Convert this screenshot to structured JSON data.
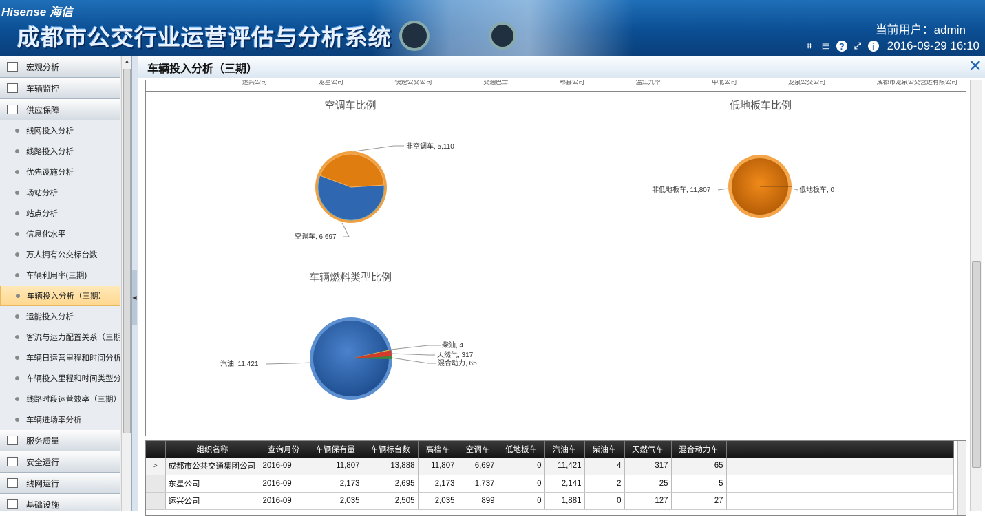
{
  "header": {
    "logo": "Hisense 海信",
    "title": "成都市公交行业运营评估与分析系统",
    "user_label": "当前用户：admin",
    "datetime": "2016-09-29 16:10"
  },
  "sidebar": {
    "groups_top": [
      {
        "label": "宏观分析",
        "icon": "chart-icon"
      },
      {
        "label": "车辆监控",
        "icon": "monitor-icon"
      },
      {
        "label": "供应保障",
        "icon": "supply-icon"
      }
    ],
    "items": [
      {
        "label": "线网投入分析"
      },
      {
        "label": "线路投入分析"
      },
      {
        "label": "优先设施分析"
      },
      {
        "label": "场站分析"
      },
      {
        "label": "站点分析"
      },
      {
        "label": "信息化水平"
      },
      {
        "label": "万人拥有公交标台数"
      },
      {
        "label": "车辆利用率(三期)"
      },
      {
        "label": "车辆投入分析（三期）"
      },
      {
        "label": "运能投入分析"
      },
      {
        "label": "客流与运力配置关系（三期）"
      },
      {
        "label": "车辆日运营里程和时间分析"
      },
      {
        "label": "车辆投入里程和时间类型分析"
      },
      {
        "label": "线路时段运营效率（三期）"
      },
      {
        "label": "车辆进场率分析"
      }
    ],
    "groups_bottom": [
      {
        "label": "服务质量",
        "icon": "service-icon"
      },
      {
        "label": "安全运行",
        "icon": "safety-icon"
      },
      {
        "label": "线网运行",
        "icon": "network-icon"
      },
      {
        "label": "基础设施",
        "icon": "infra-icon"
      }
    ]
  },
  "panel": {
    "title": "车辆投入分析（三期）",
    "top_strip": [
      "运兴公司",
      "龙星公司",
      "快速公交公司",
      "交通巴士",
      "郫县公司",
      "温江九华",
      "中北公司",
      "龙泉公交公司",
      "成都市龙泉公交营运有限公司"
    ]
  },
  "charts": {
    "ac": {
      "title": "空调车比例",
      "labels": [
        "非空调车, 5,110",
        "空调车, 6,697"
      ]
    },
    "lowfloor": {
      "title": "低地板车比例",
      "labels": [
        "非低地板车, 11,807",
        "低地板车, 0"
      ]
    },
    "fuel": {
      "title": "车辆燃料类型比例",
      "labels": [
        "汽油, 11,421",
        "柴油, 4",
        "天然气, 317",
        "混合动力, 65"
      ]
    }
  },
  "chart_data": [
    {
      "type": "pie",
      "title": "空调车比例",
      "categories": [
        "空调车",
        "非空调车"
      ],
      "values": [
        6697,
        5110
      ]
    },
    {
      "type": "pie",
      "title": "低地板车比例",
      "categories": [
        "非低地板车",
        "低地板车"
      ],
      "values": [
        11807,
        0
      ]
    },
    {
      "type": "pie",
      "title": "车辆燃料类型比例",
      "categories": [
        "汽油",
        "柴油",
        "天然气",
        "混合动力"
      ],
      "values": [
        11421,
        4,
        317,
        65
      ]
    }
  ],
  "table": {
    "headers": [
      "组织名称",
      "查询月份",
      "车辆保有量",
      "车辆标台数",
      "高档车",
      "空调车",
      "低地板车",
      "汽油车",
      "柴油车",
      "天然气车",
      "混合动力车"
    ],
    "rows": [
      [
        "成都市公共交通集团公司",
        "2016-09",
        "11,807",
        "13,888",
        "11,807",
        "6,697",
        "0",
        "11,421",
        "4",
        "317",
        "65"
      ],
      [
        "东星公司",
        "2016-09",
        "2,173",
        "2,695",
        "2,173",
        "1,737",
        "0",
        "2,141",
        "2",
        "25",
        "5"
      ],
      [
        "运兴公司",
        "2016-09",
        "2,035",
        "2,505",
        "2,035",
        "899",
        "0",
        "1,881",
        "0",
        "127",
        "27"
      ]
    ],
    "row_marker": ">"
  },
  "colors": {
    "blue_slice": "#2f67b1",
    "orange_slice": "#e07d10",
    "red_slice": "#d33b2b",
    "green_slice": "#3a8a3a",
    "accent": "#1e64b4"
  }
}
